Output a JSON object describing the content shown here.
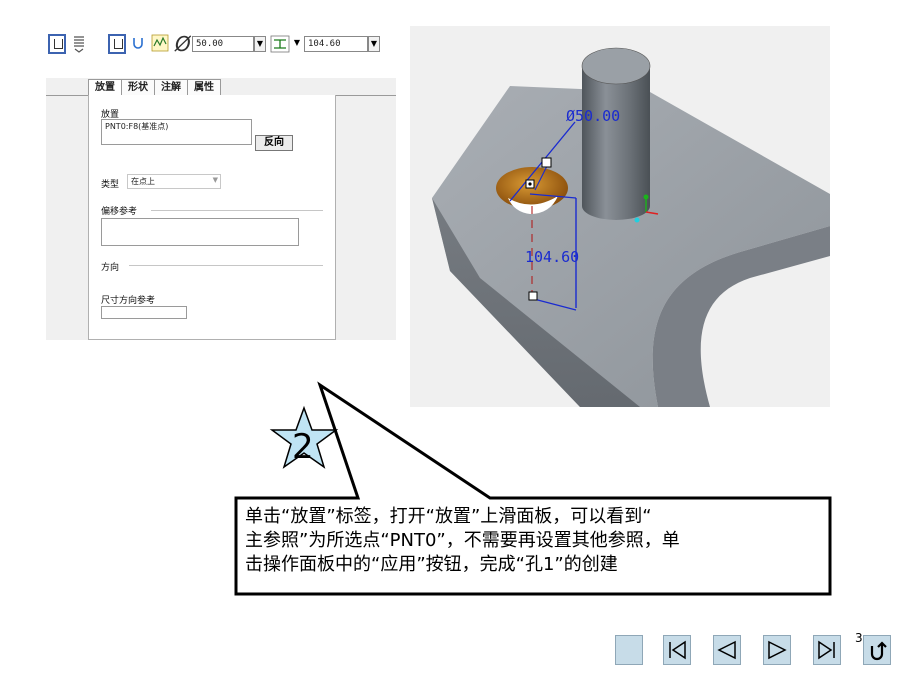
{
  "toolbar": {
    "diameter_value": "50.00",
    "depth_value": "104.60",
    "diameter_symbol": "Ø"
  },
  "panel": {
    "tabs": [
      {
        "label": "放置"
      },
      {
        "label": "形状"
      },
      {
        "label": "注解"
      },
      {
        "label": "属性"
      }
    ],
    "placement_label": "放置",
    "placement_value": "PNT0:F8(基准点)",
    "flip_button": "反向",
    "type_label": "类型",
    "type_value": "在点上",
    "offset_refs_label": "偏移参考",
    "direction_label": "方向",
    "dim_direction_label": "尺寸方向参考"
  },
  "viewport": {
    "diameter_dim": "Ø50.00",
    "depth_dim": "104.60"
  },
  "callout": {
    "step_number": "2",
    "lines": [
      "单击“放置”标签，打开“放置”上滑面板，可以看到“",
      "主参照”为所选点“PNT0”，不需要再设置其他参照，单",
      "击操作面板中的“应用”按钮，完成“孔1”的创建"
    ]
  },
  "nav": {
    "page_number": "3"
  }
}
